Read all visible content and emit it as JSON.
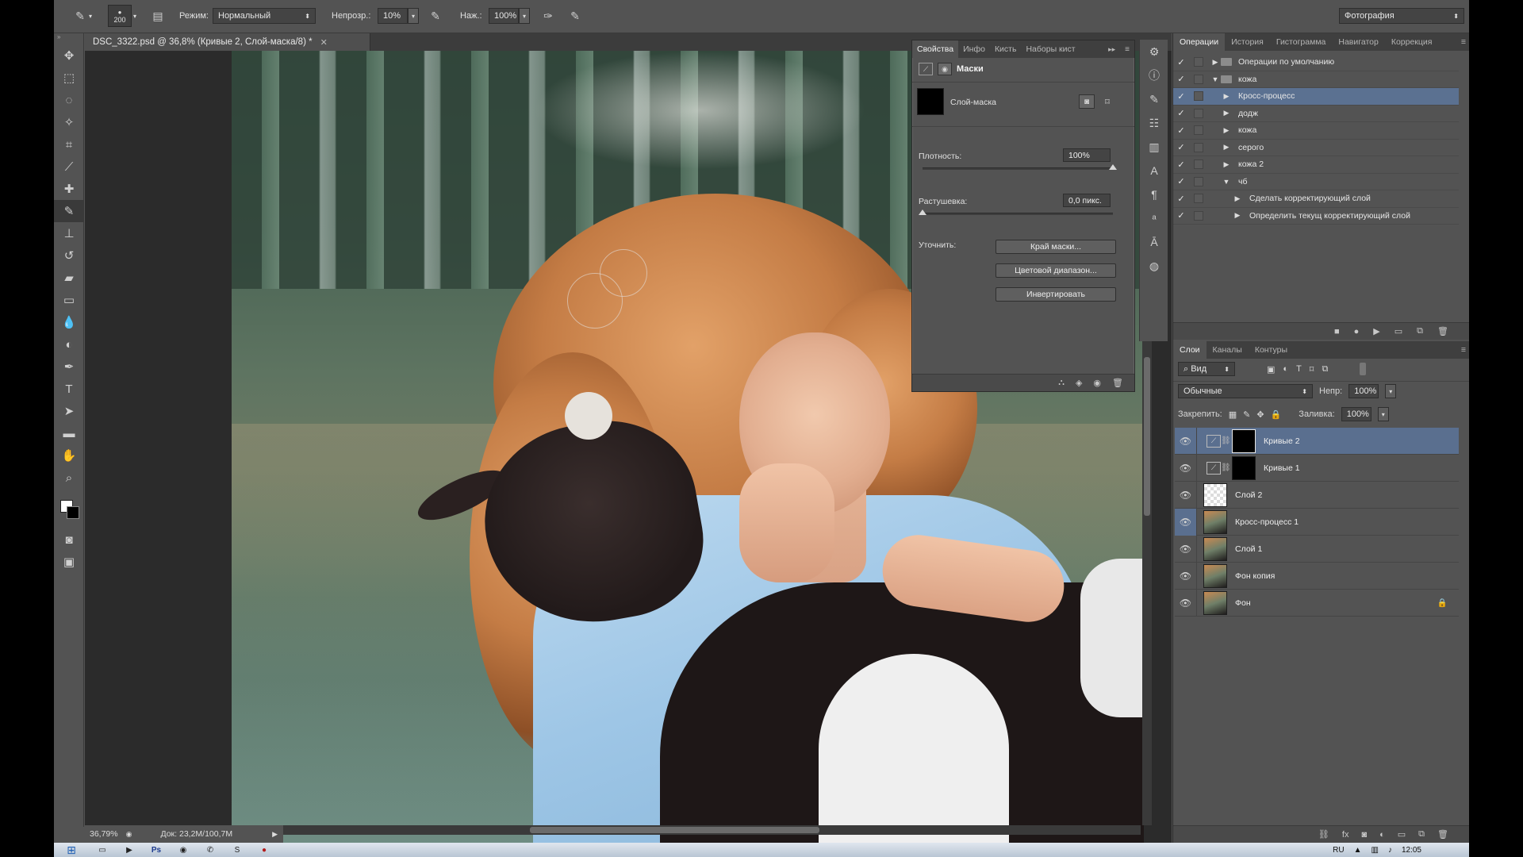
{
  "options_bar": {
    "brush_size": "200",
    "mode_label": "Режим:",
    "mode_value": "Нормальный",
    "opacity_label": "Непрозр.:",
    "opacity_value": "10%",
    "pressure_label": "Наж.:",
    "pressure_value": "100%",
    "workspace_value": "Фотография"
  },
  "document": {
    "tab_title": "DSC_3322.psd @ 36,8% (Кривые 2, Слой-маска/8) *",
    "zoom": "36,79%",
    "doc_size": "Док: 23,2M/100,7M"
  },
  "properties": {
    "tabs": [
      "Свойства",
      "Инфо",
      "Кисть",
      "Наборы кист"
    ],
    "section": "Маски",
    "mask_name": "Слой-маска",
    "density_label": "Плотность:",
    "density_value": "100%",
    "density_fraction": 1.0,
    "feather_label": "Растушевка:",
    "feather_value": "0,0 пикс.",
    "feather_fraction": 0.0,
    "refine_label": "Уточнить:",
    "buttons": [
      "Край маски...",
      "Цветовой диапазон...",
      "Инвертировать"
    ]
  },
  "actions_panel": {
    "tabs": [
      "Операции",
      "История",
      "Гистограмма",
      "Навигатор",
      "Коррекция"
    ],
    "rows": [
      {
        "label": "Операции по умолчанию",
        "kind": "set",
        "indent": 0,
        "expanded": false
      },
      {
        "label": "кожа",
        "kind": "set",
        "indent": 0,
        "expanded": true
      },
      {
        "label": "Кросс-процесс",
        "kind": "action",
        "indent": 1,
        "selected": true
      },
      {
        "label": "додж",
        "kind": "action",
        "indent": 1
      },
      {
        "label": "кожа",
        "kind": "action",
        "indent": 1
      },
      {
        "label": "серого",
        "kind": "action",
        "indent": 1
      },
      {
        "label": "кожа 2",
        "kind": "action",
        "indent": 1
      },
      {
        "label": "чб",
        "kind": "action",
        "indent": 1,
        "expanded": true
      },
      {
        "label": "Сделать корректирующий слой",
        "kind": "step",
        "indent": 2
      },
      {
        "label": "Определить текущ корректирующий слой",
        "kind": "step",
        "indent": 2
      }
    ]
  },
  "layers_panel": {
    "tabs": [
      "Слои",
      "Каналы",
      "Контуры"
    ],
    "filter_value": "Вид",
    "blend_value": "Обычные",
    "opacity_label": "Непр:",
    "opacity_value": "100%",
    "lock_label": "Закрепить:",
    "fill_label": "Заливка:",
    "fill_value": "100%",
    "layers": [
      {
        "name": "Кривые 2",
        "type": "curves",
        "thumb": "black",
        "selected": true
      },
      {
        "name": "Кривые 1",
        "type": "curves",
        "thumb": "black"
      },
      {
        "name": "Слой 2",
        "type": "pixel",
        "thumb": "checker"
      },
      {
        "name": "Кросс-процесс 1",
        "type": "pixel",
        "thumb": "photo",
        "eye_highlight": true
      },
      {
        "name": "Слой 1",
        "type": "pixel",
        "thumb": "photo"
      },
      {
        "name": "Фон копия",
        "type": "pixel",
        "thumb": "photo"
      },
      {
        "name": "Фон",
        "type": "pixel",
        "thumb": "photo",
        "locked": true
      }
    ]
  },
  "taskbar": {
    "language": "RU",
    "clock": "12:05"
  },
  "colors": {
    "ui_bg": "#535353",
    "selection": "#5a6f8f",
    "canvas_bg": "#2b2b2b"
  }
}
